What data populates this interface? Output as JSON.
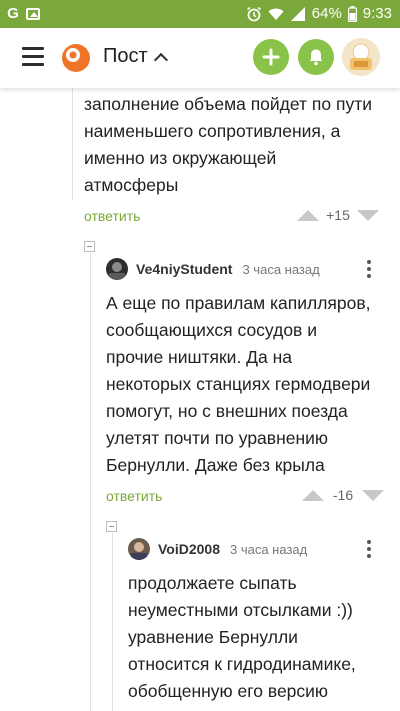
{
  "status_bar": {
    "battery": "64%",
    "time": "9:33"
  },
  "app_bar": {
    "title": "Пост"
  },
  "comments": [
    {
      "text_lines": [
        "заполнение объема пойдет по пути",
        "наименьшего сопротивления, а",
        "именно из окружающей",
        "атмосферы"
      ],
      "reply_label": "ответить",
      "rating": "+15"
    },
    {
      "author": "Ve4niyStudent",
      "time": "3 часа назад",
      "text_lines": [
        "А еще по правилам капилляров,",
        "сообщающихся сосудов и",
        "прочие ништяки. Да на",
        "некоторых станциях гермодвери",
        "помогут, но с внешних поезда",
        "улетят почти по уравнению",
        "Бернулли. Даже без крыла"
      ],
      "reply_label": "ответить",
      "rating": "-16"
    },
    {
      "author": "VoiD2008",
      "time": "3 часа назад",
      "text_lines": [
        "продолжаете сыпать",
        "неуместными отсылками :))",
        "уравнение Бернулли",
        "относится к гидродинамике,",
        "обобщенную его версию"
      ]
    }
  ],
  "colors": {
    "status_bar": "#7aa83a",
    "accent_green": "#8ac34a",
    "link_green": "#7aa83a",
    "logo_orange": "#f07427"
  }
}
